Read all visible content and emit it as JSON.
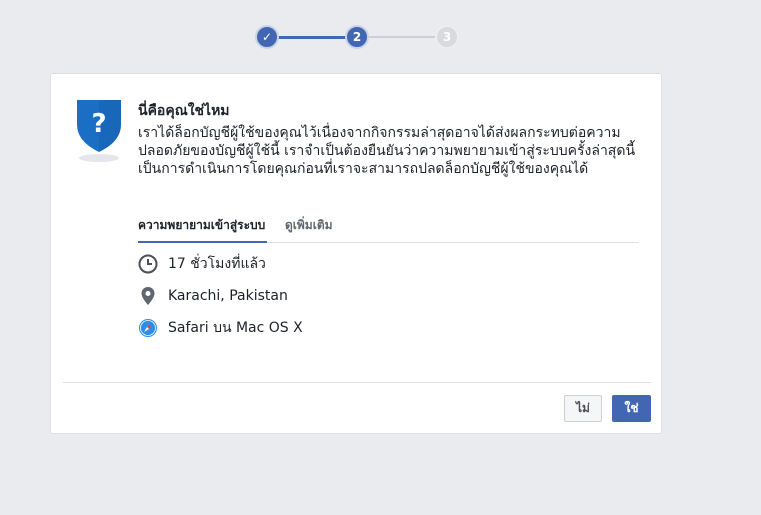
{
  "stepper": {
    "step1_label": "✓",
    "step2_label": "2",
    "step3_label": "3"
  },
  "dialog": {
    "title": "นี่คือคุณใช่ไหม",
    "description": "เราได้ล็อกบัญชีผู้ใช้ของคุณไว้เนื่องจากกิจกรรมล่าสุดอาจได้ส่งผลกระทบต่อความปลอดภัยของบัญชีผู้ใช้นี้ เราจำเป็นต้องยืนยันว่าความพยายามเข้าสู่ระบบครั้งล่าสุดนี้เป็นการดำเนินการโดยคุณก่อนที่เราจะสามารถปลดล็อกบัญชีผู้ใช้ของคุณได้",
    "shield_symbol": "?",
    "tabs": [
      {
        "label": "ความพยายามเข้าสู่ระบบ"
      },
      {
        "label": "ดูเพิ่มเติม"
      }
    ],
    "details": {
      "time": "17 ชั่วโมงที่แล้ว",
      "location": "Karachi, Pakistan",
      "device": "Safari บน Mac OS X"
    },
    "buttons": {
      "no": "ไม่",
      "yes": "ใช่"
    }
  },
  "colors": {
    "accent": "#4267b2",
    "background": "#e9ebee",
    "shield": "#1a6fc4"
  },
  "icons": {
    "time": "clock-icon",
    "location": "location-pin-icon",
    "device": "safari-compass-icon",
    "shield": "shield-question-icon",
    "step_done": "checkmark-icon"
  }
}
